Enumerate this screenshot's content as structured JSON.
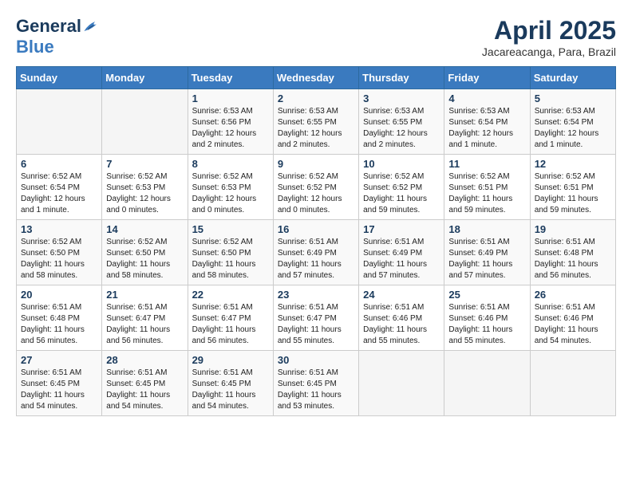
{
  "logo": {
    "general": "General",
    "blue": "Blue"
  },
  "title": "April 2025",
  "subtitle": "Jacareacanga, Para, Brazil",
  "days_of_week": [
    "Sunday",
    "Monday",
    "Tuesday",
    "Wednesday",
    "Thursday",
    "Friday",
    "Saturday"
  ],
  "weeks": [
    [
      {
        "day": "",
        "info": ""
      },
      {
        "day": "",
        "info": ""
      },
      {
        "day": "1",
        "info": "Sunrise: 6:53 AM\nSunset: 6:56 PM\nDaylight: 12 hours and 2 minutes."
      },
      {
        "day": "2",
        "info": "Sunrise: 6:53 AM\nSunset: 6:55 PM\nDaylight: 12 hours and 2 minutes."
      },
      {
        "day": "3",
        "info": "Sunrise: 6:53 AM\nSunset: 6:55 PM\nDaylight: 12 hours and 2 minutes."
      },
      {
        "day": "4",
        "info": "Sunrise: 6:53 AM\nSunset: 6:54 PM\nDaylight: 12 hours and 1 minute."
      },
      {
        "day": "5",
        "info": "Sunrise: 6:53 AM\nSunset: 6:54 PM\nDaylight: 12 hours and 1 minute."
      }
    ],
    [
      {
        "day": "6",
        "info": "Sunrise: 6:52 AM\nSunset: 6:54 PM\nDaylight: 12 hours and 1 minute."
      },
      {
        "day": "7",
        "info": "Sunrise: 6:52 AM\nSunset: 6:53 PM\nDaylight: 12 hours and 0 minutes."
      },
      {
        "day": "8",
        "info": "Sunrise: 6:52 AM\nSunset: 6:53 PM\nDaylight: 12 hours and 0 minutes."
      },
      {
        "day": "9",
        "info": "Sunrise: 6:52 AM\nSunset: 6:52 PM\nDaylight: 12 hours and 0 minutes."
      },
      {
        "day": "10",
        "info": "Sunrise: 6:52 AM\nSunset: 6:52 PM\nDaylight: 11 hours and 59 minutes."
      },
      {
        "day": "11",
        "info": "Sunrise: 6:52 AM\nSunset: 6:51 PM\nDaylight: 11 hours and 59 minutes."
      },
      {
        "day": "12",
        "info": "Sunrise: 6:52 AM\nSunset: 6:51 PM\nDaylight: 11 hours and 59 minutes."
      }
    ],
    [
      {
        "day": "13",
        "info": "Sunrise: 6:52 AM\nSunset: 6:50 PM\nDaylight: 11 hours and 58 minutes."
      },
      {
        "day": "14",
        "info": "Sunrise: 6:52 AM\nSunset: 6:50 PM\nDaylight: 11 hours and 58 minutes."
      },
      {
        "day": "15",
        "info": "Sunrise: 6:52 AM\nSunset: 6:50 PM\nDaylight: 11 hours and 58 minutes."
      },
      {
        "day": "16",
        "info": "Sunrise: 6:51 AM\nSunset: 6:49 PM\nDaylight: 11 hours and 57 minutes."
      },
      {
        "day": "17",
        "info": "Sunrise: 6:51 AM\nSunset: 6:49 PM\nDaylight: 11 hours and 57 minutes."
      },
      {
        "day": "18",
        "info": "Sunrise: 6:51 AM\nSunset: 6:49 PM\nDaylight: 11 hours and 57 minutes."
      },
      {
        "day": "19",
        "info": "Sunrise: 6:51 AM\nSunset: 6:48 PM\nDaylight: 11 hours and 56 minutes."
      }
    ],
    [
      {
        "day": "20",
        "info": "Sunrise: 6:51 AM\nSunset: 6:48 PM\nDaylight: 11 hours and 56 minutes."
      },
      {
        "day": "21",
        "info": "Sunrise: 6:51 AM\nSunset: 6:47 PM\nDaylight: 11 hours and 56 minutes."
      },
      {
        "day": "22",
        "info": "Sunrise: 6:51 AM\nSunset: 6:47 PM\nDaylight: 11 hours and 56 minutes."
      },
      {
        "day": "23",
        "info": "Sunrise: 6:51 AM\nSunset: 6:47 PM\nDaylight: 11 hours and 55 minutes."
      },
      {
        "day": "24",
        "info": "Sunrise: 6:51 AM\nSunset: 6:46 PM\nDaylight: 11 hours and 55 minutes."
      },
      {
        "day": "25",
        "info": "Sunrise: 6:51 AM\nSunset: 6:46 PM\nDaylight: 11 hours and 55 minutes."
      },
      {
        "day": "26",
        "info": "Sunrise: 6:51 AM\nSunset: 6:46 PM\nDaylight: 11 hours and 54 minutes."
      }
    ],
    [
      {
        "day": "27",
        "info": "Sunrise: 6:51 AM\nSunset: 6:45 PM\nDaylight: 11 hours and 54 minutes."
      },
      {
        "day": "28",
        "info": "Sunrise: 6:51 AM\nSunset: 6:45 PM\nDaylight: 11 hours and 54 minutes."
      },
      {
        "day": "29",
        "info": "Sunrise: 6:51 AM\nSunset: 6:45 PM\nDaylight: 11 hours and 54 minutes."
      },
      {
        "day": "30",
        "info": "Sunrise: 6:51 AM\nSunset: 6:45 PM\nDaylight: 11 hours and 53 minutes."
      },
      {
        "day": "",
        "info": ""
      },
      {
        "day": "",
        "info": ""
      },
      {
        "day": "",
        "info": ""
      }
    ]
  ]
}
